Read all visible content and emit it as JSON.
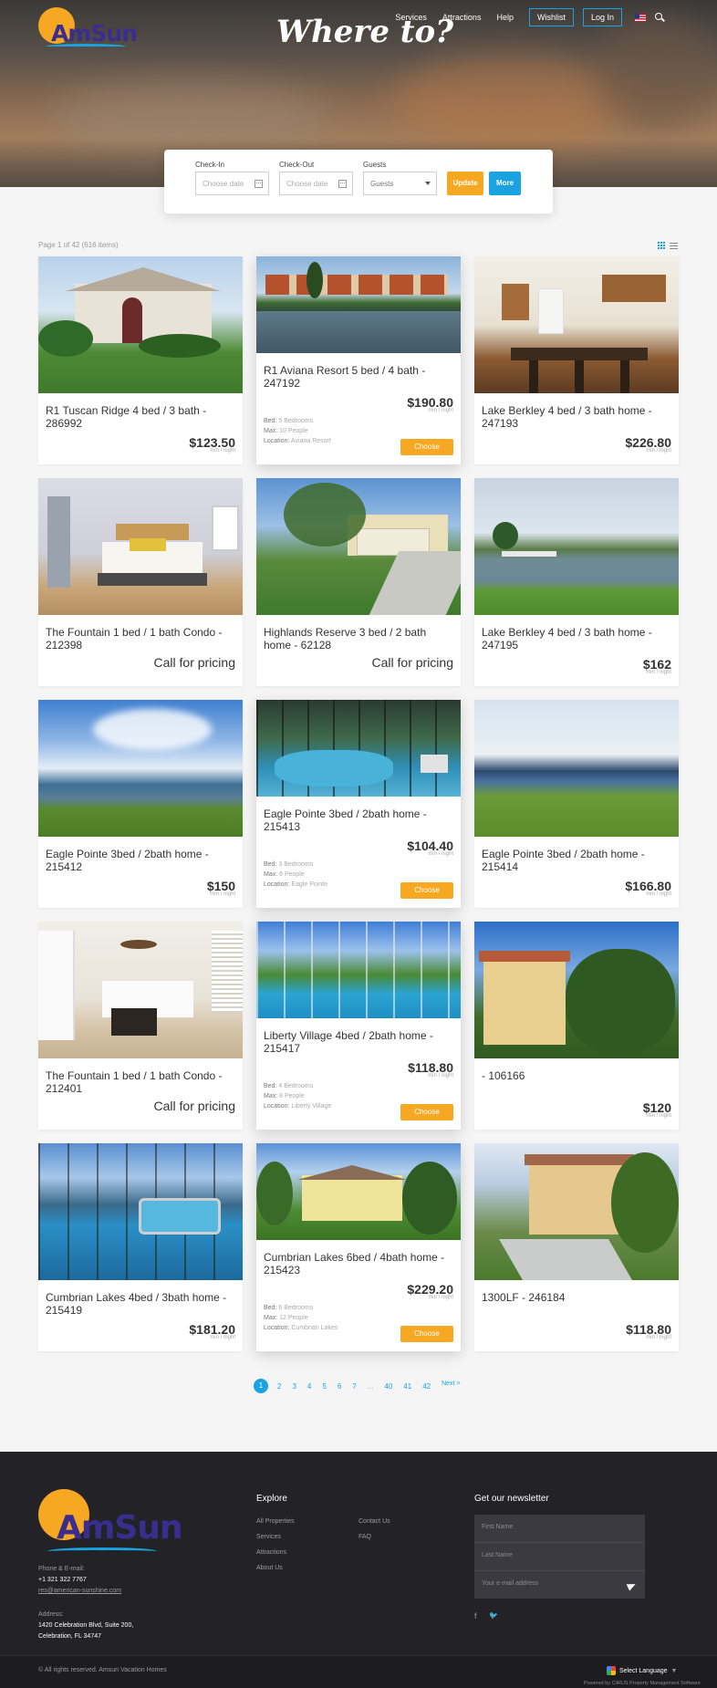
{
  "header": {
    "brand": "AmSun",
    "hero_title": "Where to?",
    "nav": [
      "Services",
      "Attractions",
      "Help"
    ],
    "wishlist": "Wishlist",
    "login": "Log In"
  },
  "search": {
    "checkin_label": "Check-In",
    "checkin_placeholder": "Choose date",
    "checkout_label": "Check-Out",
    "checkout_placeholder": "Choose date",
    "guests_label": "Guests",
    "guests_value": "Guests",
    "update": "Update",
    "more": "More"
  },
  "listing": {
    "page_info": "Page 1 of 42 (616 items)",
    "per_night": "min / night",
    "choose": "Choose",
    "bed_label": "Bed:",
    "max_label": "Max:",
    "location_label": "Location:",
    "call": "Call for pricing",
    "cards": [
      {
        "title": "R1 Tuscan Ridge 4 bed / 3 bath - 286992",
        "price": "$123.50"
      },
      {
        "title": "R1 Aviana Resort 5 bed / 4 bath - 247192",
        "price": "$190.80",
        "bed": "5 Bedrooms",
        "max": "10 People",
        "location": "Aviana Resort"
      },
      {
        "title": "Lake Berkley 4 bed / 3 bath home - 247193",
        "price": "$226.80"
      },
      {
        "title": "The Fountain 1 bed / 1 bath Condo - 212398",
        "price": ""
      },
      {
        "title": "Highlands Reserve 3 bed / 2 bath home - 62128",
        "price": ""
      },
      {
        "title": "Lake Berkley 4 bed / 3 bath home - 247195",
        "price": "$162"
      },
      {
        "title": "Eagle Pointe 3bed / 2bath home - 215412",
        "price": "$150"
      },
      {
        "title": "Eagle Pointe 3bed / 2bath home - 215413",
        "price": "$104.40",
        "bed": "3 Bedrooms",
        "max": "6 People",
        "location": "Eagle Pointe"
      },
      {
        "title": "Eagle Pointe 3bed / 2bath home - 215414",
        "price": "$166.80"
      },
      {
        "title": "The Fountain 1 bed / 1 bath Condo - 212401",
        "price": ""
      },
      {
        "title": "Liberty Village 4bed / 2bath home - 215417",
        "price": "$118.80",
        "bed": "4 Bedrooms",
        "max": "8 People",
        "location": "Liberty Village"
      },
      {
        "title": "- 106166",
        "price": "$120"
      },
      {
        "title": "Cumbrian Lakes 4bed / 3bath home - 215419",
        "price": "$181.20"
      },
      {
        "title": "Cumbrian Lakes 6bed / 4bath home - 215423",
        "price": "$229.20",
        "bed": "6 Bedrooms",
        "max": "12 People",
        "location": "Cumbrian Lakes"
      },
      {
        "title": "1300LF - 246184",
        "price": "$118.80"
      }
    ]
  },
  "pagination": {
    "pages": [
      "1",
      "2",
      "3",
      "4",
      "5",
      "6",
      "7",
      "...",
      "40",
      "41",
      "42"
    ],
    "next": "Next >"
  },
  "footer": {
    "phone_label": "Phone & E-mail:",
    "phone": "+1 321 322 7767",
    "email": "res@american-sunshine.com",
    "address_label": "Address:",
    "address_line1": "1420 Celebration Blvd, Suite 200,",
    "address_line2": "Celebration, FL 34747",
    "explore_title": "Explore",
    "explore_col1": [
      "All Properties",
      "Services",
      "Attractions",
      "About Us"
    ],
    "explore_col2": [
      "Contact Us",
      "FAQ"
    ],
    "newsletter_title": "Get our newsletter",
    "first_name": "First Name",
    "last_name": "Last Name",
    "email_placeholder": "Your e-mail address",
    "copyright": "© All rights reserved. Amsun Vacation Homes",
    "language": "Select Language",
    "language_arrow": "▼",
    "powered": "Powered by CiiRUS Property Management Software"
  },
  "colors": {
    "accent": "#1aa3e0",
    "orange": "#f7a823",
    "footer": "#232327"
  }
}
